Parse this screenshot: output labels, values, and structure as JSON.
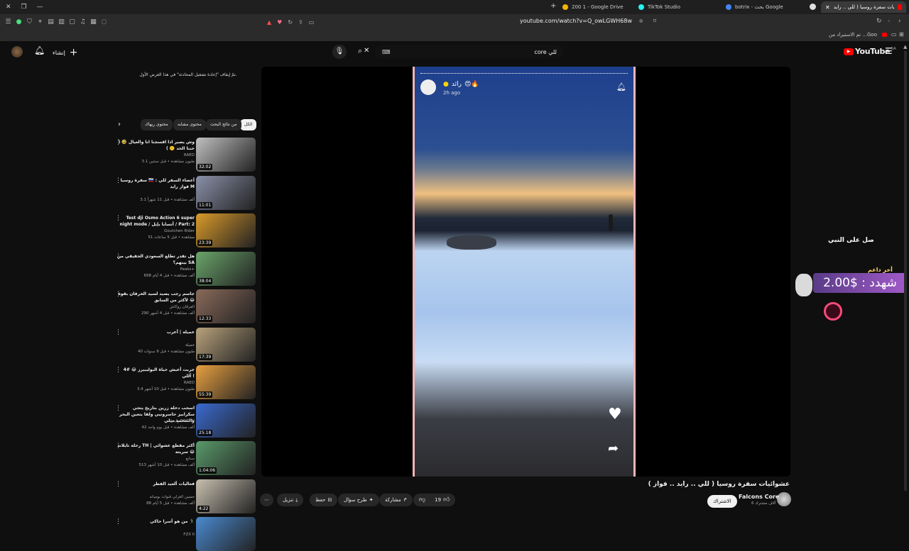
{
  "browser": {
    "tabs": [
      {
        "label": "200 1 - Google Drive",
        "color": "#f4b400"
      },
      {
        "label": "TikTok Studio",
        "color": "#25f4ee"
      },
      {
        "label": "botrix - بحث Google",
        "color": "#4285f4"
      },
      {
        "label": "عشوائيات سفرة روسيا ( للي .. رايد",
        "color": "#ff0000"
      }
    ],
    "url": "youtube.com/watch?v=Q_owLGWH68w",
    "bookmarks_text": "تم الاستيراد من ...Goo"
  },
  "masthead": {
    "logo_text": "YouTube",
    "logo_region": "SA",
    "search_value": "core للي",
    "create_label": "إنشاء"
  },
  "sidebar": {
    "notice": "تمّ إيقاف \"إعادة تشغيل المحادثة\" في هذا العرض الأول.",
    "chips": [
      "الكل",
      "من نتائج البحث",
      "محتوى مشابه",
      "محتوى ريهاك"
    ],
    "recommendations": [
      {
        "title": "وش يصير اذا اقسجنا انا والعيال 🤣 ( حبنا الحد 🤫 )",
        "channel": "RAED",
        "meta": "3.1 مليون مشاهدة • قبل سنتين",
        "duration": "32:02",
        "color": "#c0c0c0"
      },
      {
        "title": "سفرة روسيا 🇷🇺 : أعضاء السفر للي فواز رايد M",
        "channel": "",
        "meta": "3.1 ألف مشاهدة • قبل 11 شهراً",
        "duration": "11:01",
        "color": "#8a90a8"
      },
      {
        "title": "Test dji Osmo Action 6 super night mode / أتسايا بإيل / Part: 2",
        "channel": "Goutchen Rider",
        "meta": "51 مشاهدة • قبل 5 ساعات",
        "duration": "23:39",
        "color": "#d99a2a"
      },
      {
        "title": "هل تقدر تطلع السعودي الحقيقي من بينهم؟ SA",
        "channel": "Peaks+",
        "meta": "698 ألف مشاهدة • قبل 4 أيام",
        "duration": "38:04",
        "color": "#6aa56a"
      },
      {
        "title": "جاسم رجب يصيد لسيد الخرفان بقوة لأكثر من السابق 😂",
        "channel": "الفرقان روكاش",
        "meta": "290 ألف مشاهدة • قبل 4 أشهر",
        "duration": "12:33",
        "color": "#8a6a5a"
      },
      {
        "title": "خميلة | أعرب",
        "channel": "خميلة",
        "meta": "40 مليون مشاهدة • قبل 9 سنوات",
        "duration": "17:39",
        "color": "#b8a27c"
      },
      {
        "title": "جربت أعيش حياة البوليبيرز 😂 #4 آللي !",
        "channel": "RAED",
        "meta": "3.4 مليون مشاهدة • قبل 10 أشهر",
        "duration": "55:39",
        "color": "#e8a040"
      },
      {
        "title": "اسحب دخلة زرين بتاريخ يتحي سكرابيز حاسرونيي ولقا بتعين البحر والسحمة مثلي",
        "channel": "رايدن RAYDIN",
        "meta": "42 ألف مشاهدة • قبل يوم واحد",
        "duration": "25:18",
        "color": "#3a6ad0"
      },
      {
        "title": "رحلة تايلاند TH | أكثر مقطع عشوائي سريته 😂",
        "channel": "سنابع",
        "meta": "513 ألف مشاهدة • قبل 10 أشهر",
        "duration": "1:04:06",
        "color": "#5a9a6a"
      },
      {
        "title": "فعاليات ألعيد الفطر",
        "channel": "حسين الغزلي قنوات يومياته",
        "meta": "88 ألف مشاهدة • قبل 5 أيام",
        "duration": "4:22",
        "color": "#c8c0b0"
      },
      {
        "title": "من هو أسرا حاكي 🏃‍♂️",
        "channel": "FZX II",
        "meta": "",
        "duration": "",
        "color": "#4a8ad0"
      }
    ]
  },
  "player": {
    "reel_user": "رائد",
    "reel_emoji": "😍🔥",
    "reel_time": "2h ago",
    "overlay_prayer": "صل على النبي",
    "donor_label": "أخر داعم",
    "donor_amount": "شهدد : $2.00"
  },
  "video": {
    "title": "عشوائيات سفرة روسيا ( للي .. رايد .. فواز )",
    "channel": "Falcons Core",
    "subscribers": "6 آلاف مشترك",
    "join_label": "الاشتراك",
    "likes": "19",
    "share_label": "مشاركة",
    "ask_label": "طرح سؤال",
    "save_label": "حفظ",
    "download_label": "تنزيل"
  }
}
